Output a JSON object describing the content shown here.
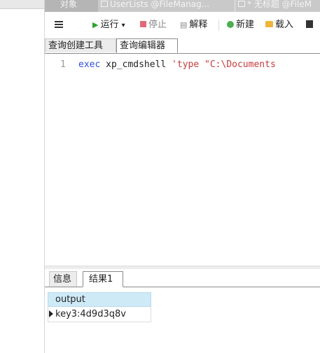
{
  "tabs": [
    {
      "label": "对象"
    },
    {
      "label": "UserLists @FileManag..."
    },
    {
      "label": "* 无标题 @FileM"
    }
  ],
  "toolbar": {
    "run": "运行",
    "run_dropdown": "▾",
    "stop": "停止",
    "explain": "解释",
    "new": "新建",
    "load": "载入"
  },
  "subtabs": {
    "builder": "查询创建工具",
    "editor": "查询编辑器"
  },
  "editor": {
    "line_number": "1",
    "code_keyword": "exec",
    "code_plain": " xp_cmdshell ",
    "code_string": "'type \"C:\\Documents"
  },
  "results": {
    "tabs": [
      "信息",
      "结果1"
    ],
    "columns": [
      "output"
    ],
    "rows": [
      [
        "key3:4d9d3q8v"
      ]
    ]
  },
  "colors": {
    "header_bg": "#cfeaf7",
    "keyword": "#3050d8",
    "string": "#c43c3c",
    "run": "#2aa52a",
    "stop": "#e06a7a"
  },
  "icons": [
    "menu-icon",
    "run-icon",
    "stop-icon",
    "explain-icon",
    "new-icon",
    "load-icon",
    "save-icon",
    "table-icon",
    "row-pointer-icon"
  ]
}
